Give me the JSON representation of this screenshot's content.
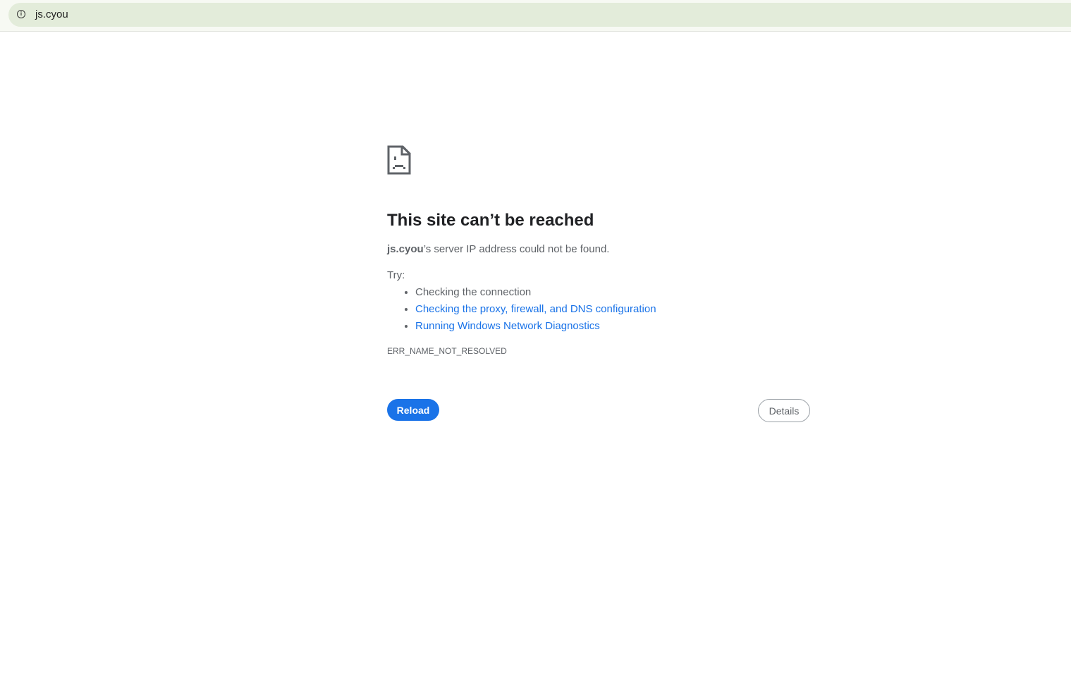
{
  "address_bar": {
    "url": "js.cyou",
    "icon": "info-icon"
  },
  "error": {
    "icon": "sad-page-icon",
    "title": "This site can’t be reached",
    "host": "js.cyou",
    "message_rest": "’s server IP address could not be found.",
    "try_label": "Try:",
    "suggestions": [
      {
        "text": "Checking the connection",
        "link": false
      },
      {
        "text": "Checking the proxy, firewall, and DNS configuration",
        "link": true
      },
      {
        "text": "Running Windows Network Diagnostics",
        "link": true
      }
    ],
    "code": "ERR_NAME_NOT_RESOLVED"
  },
  "buttons": {
    "reload": "Reload",
    "details": "Details"
  },
  "colors": {
    "accent": "#1a73e8",
    "omnibox": "#e3ecda"
  }
}
